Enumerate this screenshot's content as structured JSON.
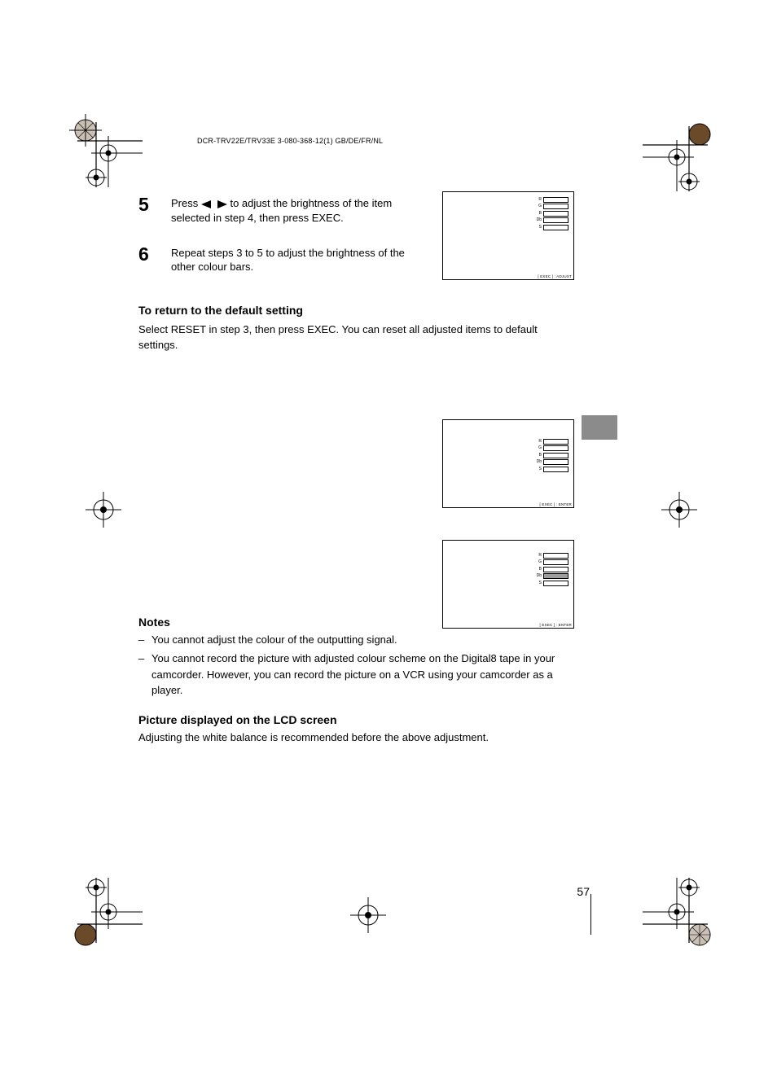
{
  "header": "DCR-TRV22E/TRV33E 3-080-368-12(1) GB/DE/FR/NL",
  "steps": {
    "s5": {
      "num": "5",
      "prefix": "Press ",
      "arrows_alt": "left/right",
      "suffix": " to adjust the brightness of the item selected in step 4, then press EXEC."
    },
    "s6": {
      "num": "6",
      "text": "Repeat steps 3 to 5 to adjust the brightness of the other colour bars."
    }
  },
  "reset_heading": "To return to the default setting",
  "reset_text": "Select RESET in step 3, then press EXEC. You can reset all adjusted items to default settings.",
  "screen_meters": [
    "R",
    "G",
    "B",
    "Db",
    "S"
  ],
  "screen_caption1": "[ EXEC ] : ADJUST",
  "screen_caption2": "[ EXEC ] : ENTER",
  "notes_heading": "Notes",
  "notes": [
    "You cannot adjust the colour of the outputting signal.",
    "You cannot record the picture with adjusted colour scheme on the Digital8 tape in your camcorder. However, you can record the picture on a VCR using your camcorder as a player."
  ],
  "lcd_heading": "Picture displayed on the LCD screen",
  "lcd_text": "Adjusting the white balance is recommended before the above adjustment.",
  "page_number": "57"
}
